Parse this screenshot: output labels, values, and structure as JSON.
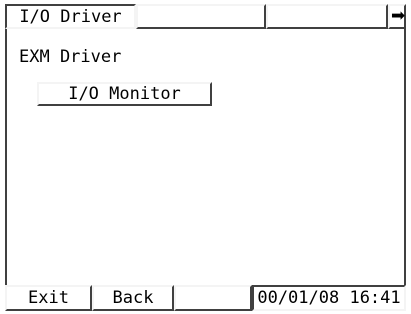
{
  "top_tabs": [
    {
      "label": "I/O Driver",
      "active": true
    },
    {
      "label": ""
    },
    {
      "label": ""
    }
  ],
  "next_arrow": "➡",
  "main": {
    "section_label": "EXM Driver",
    "io_monitor_button": "I/O Monitor"
  },
  "bottom_bar": {
    "exit_label": "Exit",
    "back_label": "Back",
    "blank_label": "",
    "datetime": "00/01/08 16:41"
  },
  "colors": {
    "background": "#ffffff",
    "bevel_light": "#f4f4f4",
    "bevel_dark": "#404040",
    "text": "#000000"
  },
  "icons": {
    "next": "arrow-right-icon"
  }
}
